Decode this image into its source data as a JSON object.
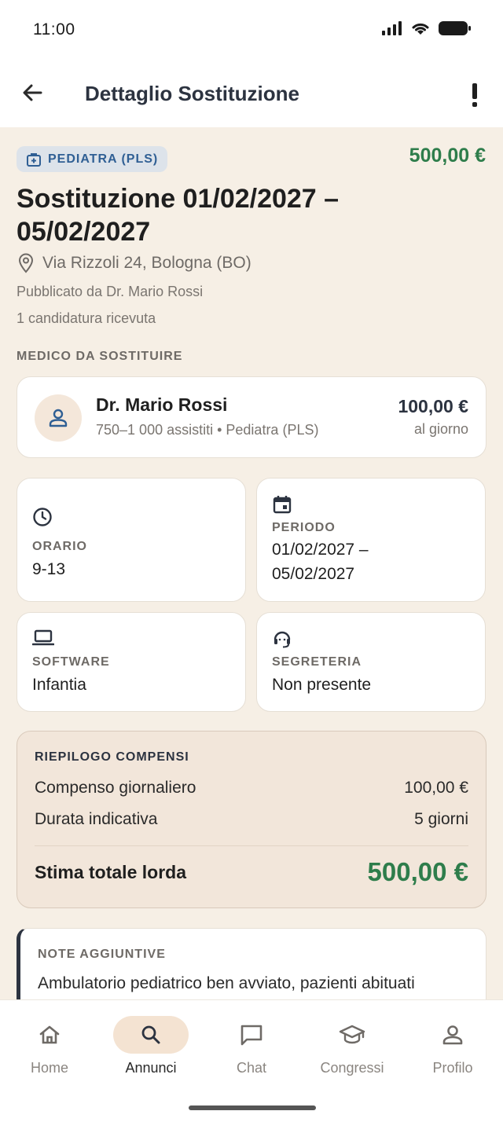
{
  "status_bar": {
    "time": "11:00"
  },
  "header": {
    "title": "Dettaglio Sostituzione"
  },
  "listing": {
    "badge": "PEDIATRA (PLS)",
    "total_price": "500,00 €",
    "title": "Sostituzione 01/02/2027 – 05/02/2027",
    "address": "Via Rizzoli 24, Bologna (BO)",
    "published_by": "Pubblicato da Dr. Mario Rossi",
    "applications": "1 candidatura ricevuta"
  },
  "doctor_section": {
    "label": "MEDICO DA SOSTITUIRE",
    "name": "Dr. Mario Rossi",
    "subtitle": "750–1 000 assistiti • Pediatra (PLS)",
    "price": "100,00 €",
    "price_unit": "al giorno"
  },
  "info_cards": {
    "schedule": {
      "label": "ORARIO",
      "value": "9-13",
      "icon": "clock-icon"
    },
    "period": {
      "label": "PERIODO",
      "line1": "01/02/2027 –",
      "line2": "05/02/2027",
      "icon": "calendar-icon"
    },
    "software": {
      "label": "SOFTWARE",
      "value": "Infantia",
      "icon": "laptop-icon"
    },
    "secretary": {
      "label": "SEGRETERIA",
      "value": "Non presente",
      "icon": "headset-icon"
    }
  },
  "summary": {
    "title": "RIEPILOGO COMPENSI",
    "rows": [
      {
        "label": "Compenso giornaliero",
        "value": "100,00 €"
      },
      {
        "label": "Durata indicativa",
        "value": "5 giorni"
      }
    ],
    "total_label": "Stima totale lorda",
    "total_value": "500,00 €"
  },
  "notes": {
    "title": "NOTE AGGIUNTIVE",
    "text": "Ambulatorio pediatrico ben avviato, pazienti abituati"
  },
  "nav": {
    "items": [
      {
        "label": "Home",
        "icon": "home-icon",
        "active": false
      },
      {
        "label": "Annunci",
        "icon": "search-icon",
        "active": true
      },
      {
        "label": "Chat",
        "icon": "chat-icon",
        "active": false
      },
      {
        "label": "Congressi",
        "icon": "graduation-cap-icon",
        "active": false
      },
      {
        "label": "Profilo",
        "icon": "user-icon",
        "active": false
      }
    ]
  },
  "colors": {
    "accent_green": "#2e7d4b",
    "navy": "#2c3340",
    "background": "#f6efe5",
    "badge_blue": "#2f5f94"
  }
}
